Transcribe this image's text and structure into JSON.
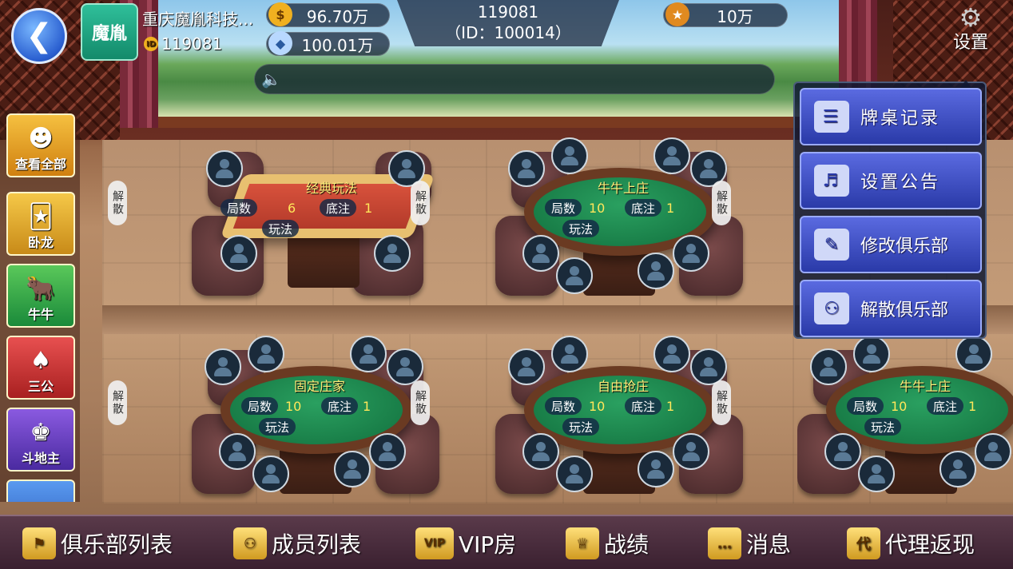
{
  "header": {
    "club_logo_text": "魔胤",
    "club_name": "重庆魔胤科技...",
    "club_id": "119081",
    "coins": "96.70万",
    "diamonds": "100.01万",
    "user_name": "119081",
    "user_id": "（ID：100014）",
    "gold": "10万",
    "settings_label": "设置"
  },
  "games": [
    {
      "label": "查看全部",
      "icon": "girl-avatar-icon",
      "color": "#f0a020"
    },
    {
      "label": "卧龙",
      "icon": "cards-icon",
      "color": "#f0b030"
    },
    {
      "label": "牛牛",
      "icon": "cow-icon",
      "color": "#2a9a4a"
    },
    {
      "label": "三公",
      "icon": "playing-cards-icon",
      "color": "#d03030"
    },
    {
      "label": "斗地主",
      "icon": "landlord-icon",
      "color": "#6a3ac0"
    }
  ],
  "tables": [
    {
      "title": "经典玩法",
      "rounds_label": "局数",
      "rounds": "6",
      "bet_label": "底注",
      "bet": "1",
      "rules": "玩法",
      "dissolve": "解散"
    },
    {
      "title": "牛牛上庄",
      "rounds_label": "局数",
      "rounds": "10",
      "bet_label": "底注",
      "bet": "1",
      "rules": "玩法",
      "dissolve": "解散"
    },
    {
      "title": "固定庄家",
      "rounds_label": "局数",
      "rounds": "10",
      "bet_label": "底注",
      "bet": "1",
      "rules": "玩法",
      "dissolve": "解散"
    },
    {
      "title": "自由抢庄",
      "rounds_label": "局数",
      "rounds": "10",
      "bet_label": "底注",
      "bet": "1",
      "rules": "玩法",
      "dissolve": "解散"
    },
    {
      "title": "牛牛上庄",
      "rounds_label": "局数",
      "rounds": "10",
      "bet_label": "底注",
      "bet": "1",
      "rules": "玩法",
      "dissolve": ""
    }
  ],
  "menu": [
    {
      "label": "牌桌记录",
      "icon": "notepad-icon"
    },
    {
      "label": "设置公告",
      "icon": "speaker-icon"
    },
    {
      "label": "修改俱乐部",
      "icon": "edit-icon"
    },
    {
      "label": "解散俱乐部",
      "icon": "users-icon"
    }
  ],
  "nav": [
    {
      "label": "俱乐部列表",
      "icon": "flag-icon"
    },
    {
      "label": "成员列表",
      "icon": "members-icon"
    },
    {
      "label": "VIP房",
      "icon": "vip-icon",
      "badge": "VIP"
    },
    {
      "label": "战绩",
      "icon": "trophy-icon"
    },
    {
      "label": "消息",
      "icon": "message-icon"
    },
    {
      "label": "代理返现",
      "icon": "agent-gear-icon",
      "badge": "代"
    }
  ]
}
